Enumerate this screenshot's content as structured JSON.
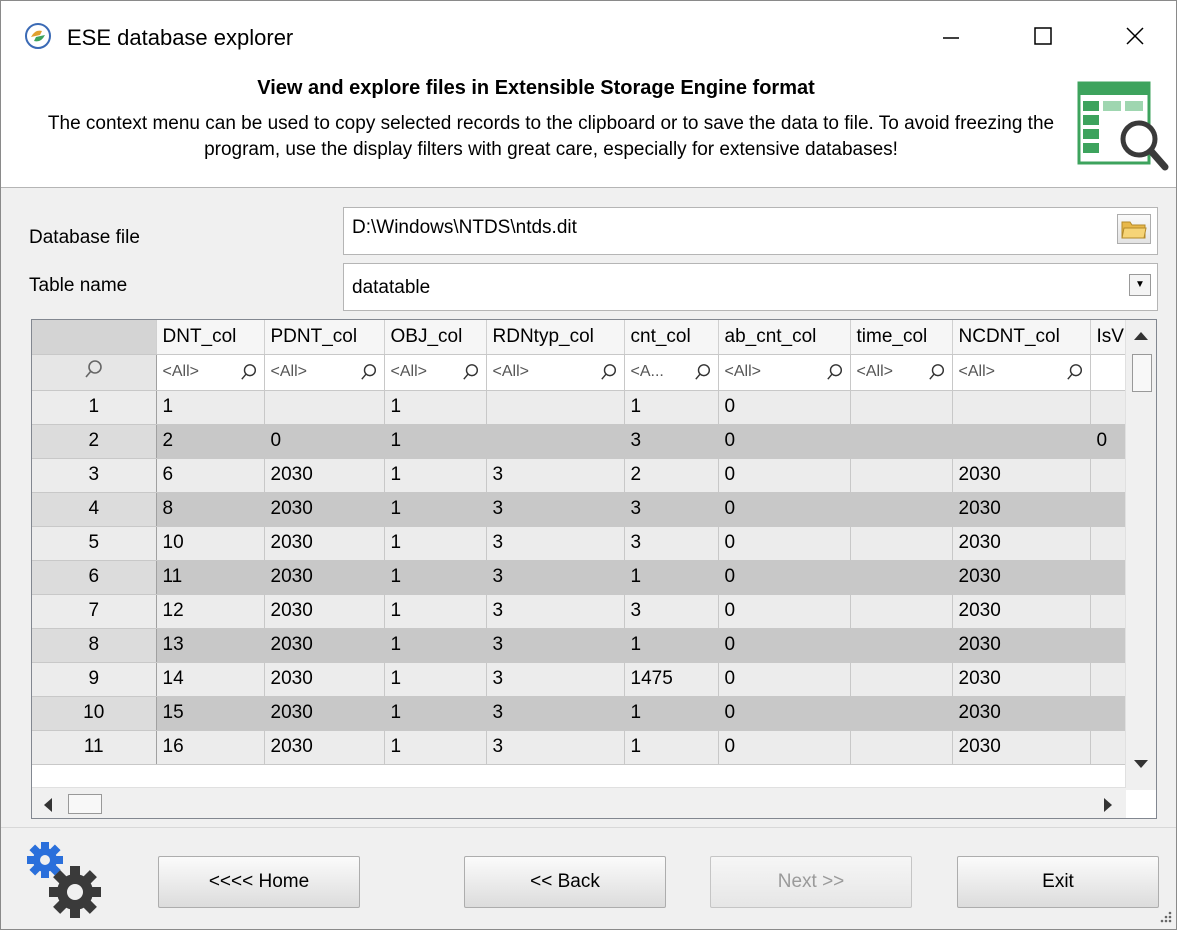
{
  "window": {
    "title": "ESE database explorer"
  },
  "header": {
    "title": "View and explore files in Extensible Storage Engine format",
    "description": "The context menu can be used to copy selected records to the clipboard or to save the data to file. To avoid freezing the program, use the display filters with great care, especially for extensive databases!"
  },
  "form": {
    "database_file_label": "Database file",
    "database_file_value": "D:\\Windows\\NTDS\\ntds.dit",
    "table_name_label": "Table name",
    "table_name_value": "datatable"
  },
  "grid": {
    "columns": [
      "DNT_col",
      "PDNT_col",
      "OBJ_col",
      "RDNtyp_col",
      "cnt_col",
      "ab_cnt_col",
      "time_col",
      "NCDNT_col",
      "IsV"
    ],
    "filters": [
      "<All>",
      "<All>",
      "<All>",
      "<All>",
      "<A...",
      "<All>",
      "<All>",
      "<All>",
      ""
    ],
    "rows": [
      [
        "1",
        "1",
        "",
        "1",
        "",
        "1",
        "0",
        "",
        "",
        ""
      ],
      [
        "2",
        "2",
        "0",
        "1",
        "",
        "3",
        "0",
        "",
        "",
        "0"
      ],
      [
        "3",
        "6",
        "2030",
        "1",
        "3",
        "2",
        "0",
        "",
        "2030",
        ""
      ],
      [
        "4",
        "8",
        "2030",
        "1",
        "3",
        "3",
        "0",
        "",
        "2030",
        ""
      ],
      [
        "5",
        "10",
        "2030",
        "1",
        "3",
        "3",
        "0",
        "",
        "2030",
        ""
      ],
      [
        "6",
        "11",
        "2030",
        "1",
        "3",
        "1",
        "0",
        "",
        "2030",
        ""
      ],
      [
        "7",
        "12",
        "2030",
        "1",
        "3",
        "3",
        "0",
        "",
        "2030",
        ""
      ],
      [
        "8",
        "13",
        "2030",
        "1",
        "3",
        "1",
        "0",
        "",
        "2030",
        ""
      ],
      [
        "9",
        "14",
        "2030",
        "1",
        "3",
        "1475",
        "0",
        "",
        "2030",
        ""
      ],
      [
        "10",
        "15",
        "2030",
        "1",
        "3",
        "1",
        "0",
        "",
        "2030",
        ""
      ],
      [
        "11",
        "16",
        "2030",
        "1",
        "3",
        "1",
        "0",
        "",
        "2030",
        ""
      ]
    ]
  },
  "buttons": {
    "home": "<<<< Home",
    "back": "<< Back",
    "next": "Next >>",
    "exit": "Exit"
  },
  "colors": {
    "grid_alt_row": "#c8c8c8",
    "header_bg": "#ffffff",
    "icon_green": "#3da35d",
    "gear_blue": "#2a6fdb"
  }
}
